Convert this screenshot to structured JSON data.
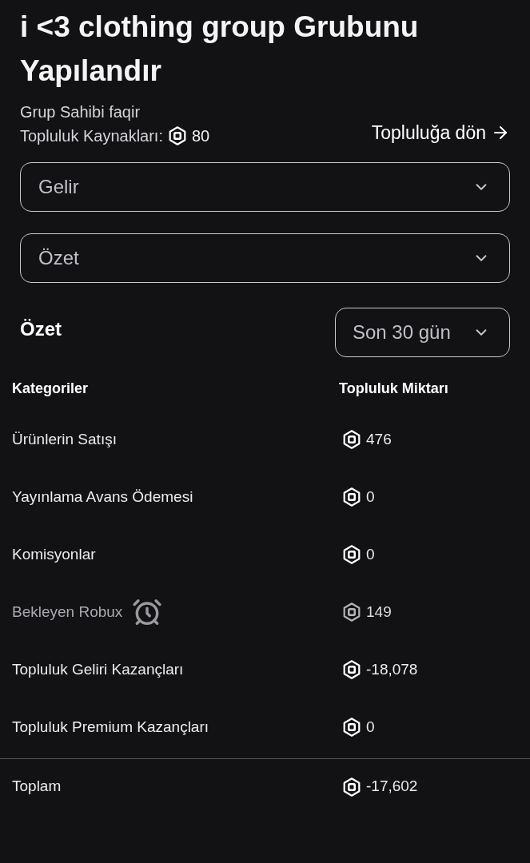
{
  "header": {
    "title": "i <3 clothing group Grubunu Yapılandır",
    "owner_line": "Grup Sahibi faqir",
    "funds_label": "Topluluk Kaynakları:",
    "funds": "80",
    "back_link": "Topluluğa dön"
  },
  "dropdowns": [
    {
      "value": "Gelir"
    },
    {
      "value": "Özet"
    }
  ],
  "summary": {
    "title": "Özet",
    "period": "Son 30 gün"
  },
  "table": {
    "columns": [
      "Kategoriler",
      "Topluluk Miktarı"
    ],
    "rows": [
      {
        "kind": "normal",
        "label": "Ürünlerin Satışı",
        "amount": "476"
      },
      {
        "kind": "normal",
        "label": "Yayınlama Avans Ödemesi",
        "amount": "0"
      },
      {
        "kind": "normal",
        "label": "Komisyonlar",
        "amount": "0"
      },
      {
        "kind": "pending",
        "label": "Bekleyen Robux",
        "amount": "149"
      },
      {
        "kind": "normal",
        "label": "Topluluk Geliri Kazançları",
        "amount": "-18,078"
      },
      {
        "kind": "normal",
        "label": "Topluluk Premium Kazançları",
        "amount": "0"
      }
    ],
    "total": {
      "label": "Toplam",
      "amount": "-17,602"
    }
  }
}
